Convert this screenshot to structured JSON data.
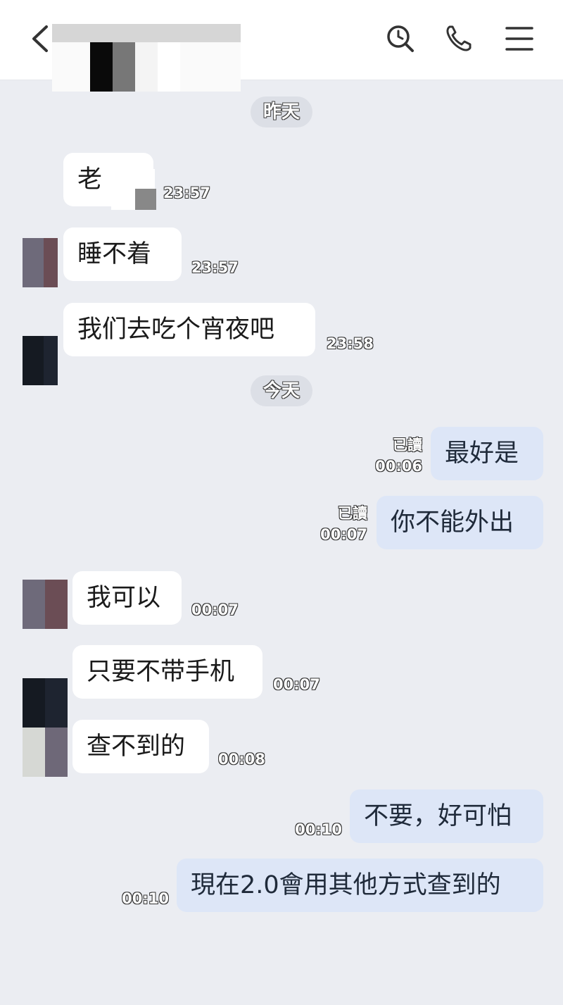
{
  "header": {
    "back_icon": "chevron-left-icon",
    "search_icon": "search-icon",
    "call_icon": "phone-icon",
    "menu_icon": "menu-icon"
  },
  "dates": {
    "yesterday": "昨天",
    "today": "今天"
  },
  "messages": [
    {
      "side": "in",
      "text": "老",
      "time": "23:57"
    },
    {
      "side": "in",
      "text": "睡不着",
      "time": "23:57"
    },
    {
      "side": "in",
      "text": "我们去吃个宵夜吧",
      "time": "23:58"
    },
    {
      "side": "out",
      "text": "最好是",
      "read": "已讀",
      "time": "00:06"
    },
    {
      "side": "out",
      "text": "你不能外出",
      "read": "已讀",
      "time": "00:07"
    },
    {
      "side": "in",
      "text": "我可以",
      "time": "00:07"
    },
    {
      "side": "in",
      "text": "只要不带手机",
      "time": "00:07"
    },
    {
      "side": "in",
      "text": "查不到的",
      "time": "00:08"
    },
    {
      "side": "out",
      "text": "不要，好可怕",
      "time": "00:10"
    },
    {
      "side": "out",
      "text": "現在2.0會用其他方式查到的",
      "time": "00:10"
    }
  ],
  "colors": {
    "background": "#ebedf2",
    "incoming_bubble": "#ffffff",
    "outgoing_bubble": "#dde6f7"
  }
}
